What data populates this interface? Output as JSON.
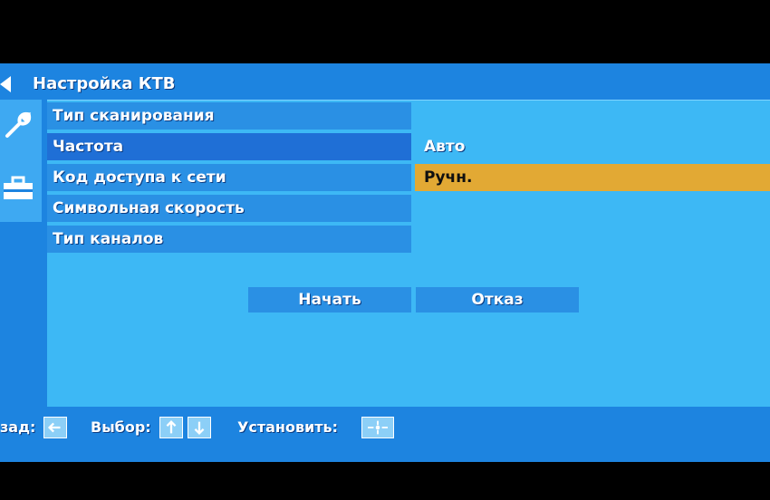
{
  "title": "Настройка КТВ",
  "menu": {
    "rows": [
      {
        "label": "Тип сканирования"
      },
      {
        "label": "Частота"
      },
      {
        "label": "Код доступа к сети"
      },
      {
        "label": "Символьная скорость"
      },
      {
        "label": "Тип каналов"
      }
    ],
    "selected_value": "Авто",
    "dropdown_option": "Ручн."
  },
  "buttons": {
    "start": "Начать",
    "cancel": "Отказ"
  },
  "footer": {
    "back_label": "зад:",
    "select_label": "Выбор:",
    "set_label": "Установить:"
  },
  "icons": {
    "back": "left-arrow-icon",
    "tools": "wrench-icon",
    "toolbox": "toolbox-icon",
    "up": "up-arrow-icon",
    "down": "down-arrow-icon",
    "ok": "ok-center-icon"
  },
  "colors": {
    "background": "#1d84e0",
    "panel": "#3db8f5",
    "highlight": "#e2a934"
  }
}
